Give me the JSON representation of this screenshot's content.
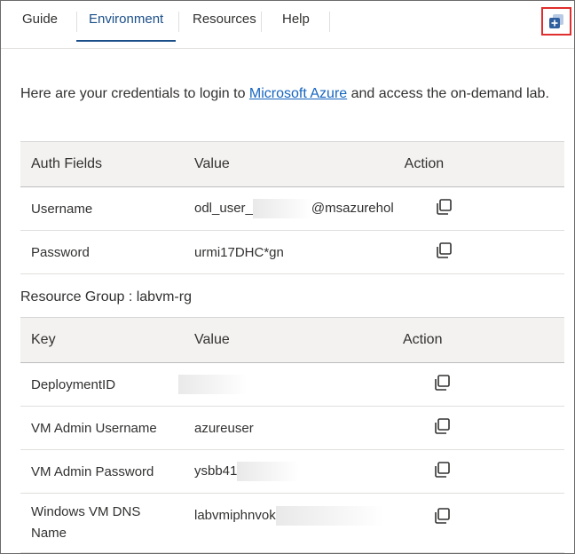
{
  "tabs": [
    {
      "label": "Guide"
    },
    {
      "label": "Environment"
    },
    {
      "label": "Resources"
    },
    {
      "label": "Help"
    }
  ],
  "active_tab": "Environment",
  "popout_icon": "popout-window-icon",
  "intro": {
    "before": "Here are your credentials to login to ",
    "link": "Microsoft Azure",
    "after": " and access the on-demand lab."
  },
  "credentials": {
    "headers": [
      "Auth Fields",
      "Value",
      "Action"
    ],
    "rows": [
      {
        "field": "Username",
        "value_start": "odl_user_",
        "value_end": "@msazurehol"
      },
      {
        "field": "Password",
        "value": "urmi17DHC*gn"
      }
    ]
  },
  "resource_group": {
    "title": "Resource Group : labvm-rg",
    "headers": [
      "Key",
      "Value",
      "Action"
    ],
    "rows": [
      {
        "key": "DeploymentID",
        "value": ""
      },
      {
        "key": "VM Admin Username",
        "value": "azureuser"
      },
      {
        "key": "VM Admin Password",
        "value": "ysbb41"
      },
      {
        "key_line1": "Windows VM DNS",
        "key_line2": "Name",
        "value": "labvmiphnvok"
      }
    ]
  },
  "colors": {
    "accent": "#1b4f8a",
    "link": "#1565c0",
    "highlight_border": "#e02d2d"
  }
}
